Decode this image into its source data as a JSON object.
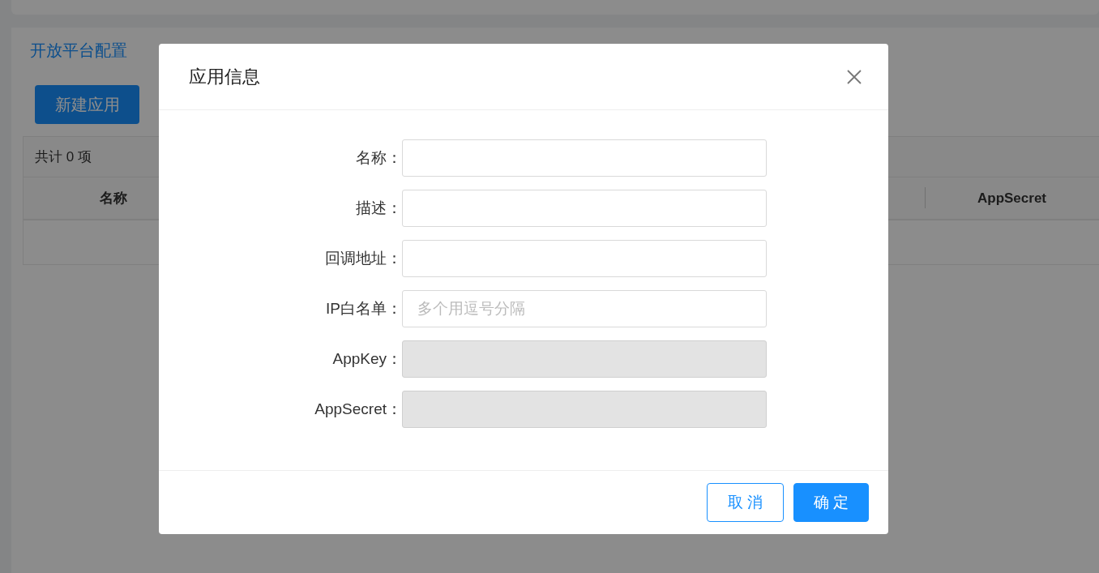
{
  "page": {
    "tabs": [
      {
        "label": "开放平台配置",
        "selected": true
      }
    ],
    "new_button": "新建应用",
    "table": {
      "summary": "共计 0 项",
      "columns": [
        {
          "label": "名称"
        },
        {
          "label": "AppSecret"
        }
      ]
    }
  },
  "dialog": {
    "title": "应用信息",
    "fields": [
      {
        "label": "名称：",
        "disabled": false
      },
      {
        "label": "描述：",
        "disabled": false
      },
      {
        "label": "回调地址：",
        "disabled": false
      },
      {
        "label": "IP白名单：",
        "placeholder": "多个用逗号分隔",
        "disabled": false
      },
      {
        "label": "AppKey：",
        "disabled": true
      },
      {
        "label": "AppSecret：",
        "disabled": true
      }
    ],
    "buttons": [
      {
        "label": "取 消",
        "kind": "default"
      },
      {
        "label": "确 定",
        "kind": "primary"
      }
    ]
  }
}
